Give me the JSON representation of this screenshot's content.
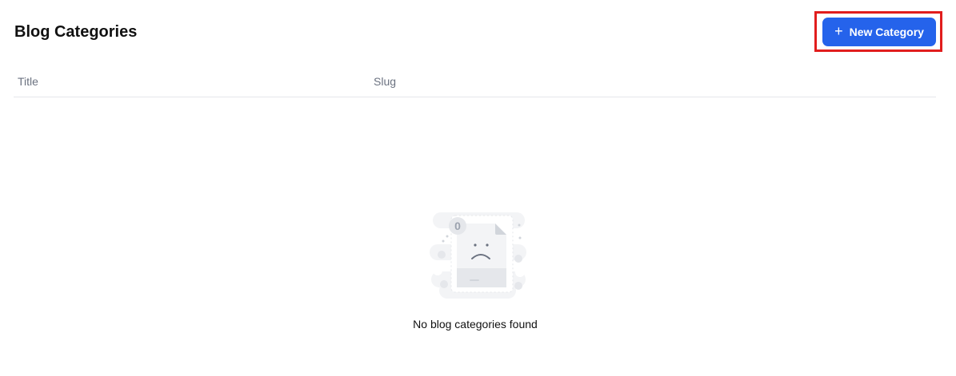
{
  "header": {
    "title": "Blog Categories",
    "new_button_label": "New Category",
    "new_button_icon": "plus-icon"
  },
  "table": {
    "columns": [
      "Title",
      "Slug"
    ]
  },
  "empty_state": {
    "badge_count": "0",
    "message": "No blog categories found",
    "icon": "sad-document-icon"
  },
  "colors": {
    "accent": "#2563eb",
    "highlight": "#e11d1d"
  }
}
